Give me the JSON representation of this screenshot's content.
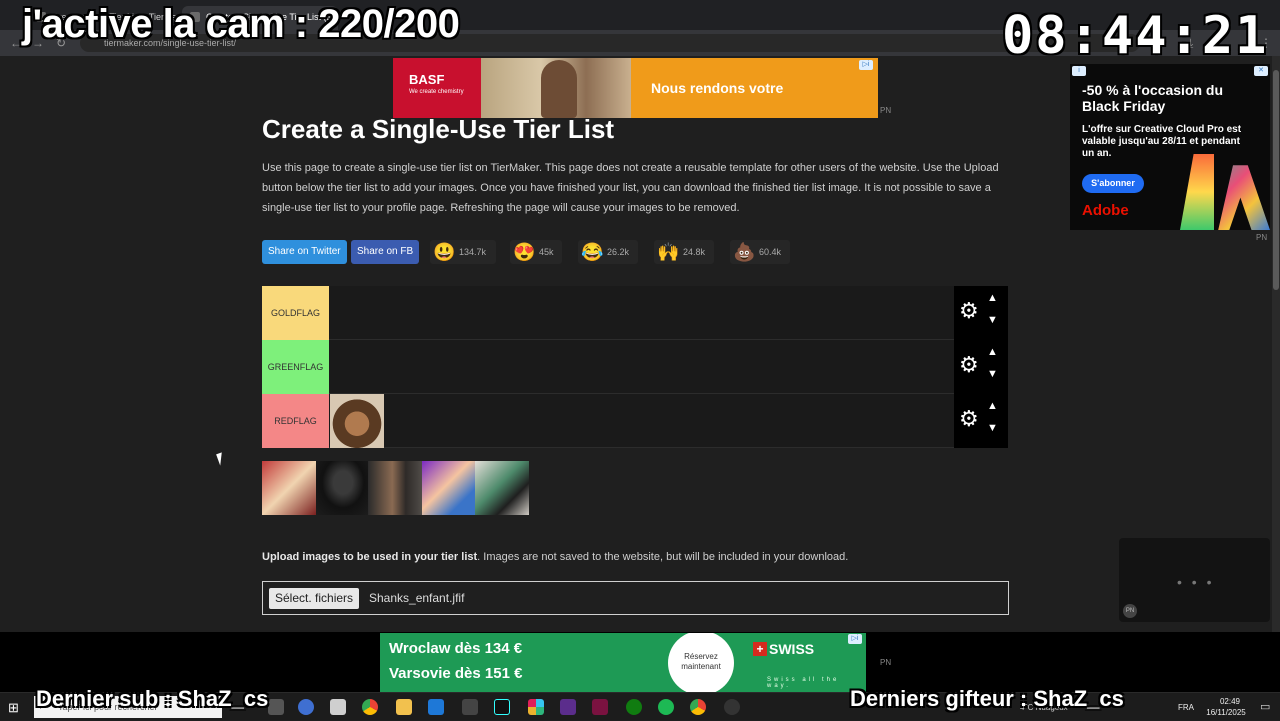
{
  "browser": {
    "tabs": [
      {
        "label": "Create a New Tier List - TierMa"
      },
      {
        "label": "Create a Single-Use Tier List (B"
      }
    ],
    "url": "tiermaker.com/single-use-tier-list/"
  },
  "overlay": {
    "title": "j'active la cam : 220/200",
    "clock": "08:44:21",
    "last_sub": "Dernier sub : ShaZ_cs",
    "last_gifter": "Derniers gifteur : ShaZ_cs"
  },
  "ad_top": {
    "brand": "BASF",
    "brand_tagline": "We create chemistry",
    "text": "Nous rendons votre",
    "pn": "PN"
  },
  "page": {
    "title": "Create a Single-Use Tier List",
    "description": "Use this page to create a single-use tier list on TierMaker. This page does not create a reusable template for other users of the website. Use the Upload button below the tier list to add your images. Once you have finished your list, you can download the finished tier list image. It is not possible to save a single-use tier list to your profile page. Refreshing the page will cause your images to be removed.",
    "share_twitter": "Share on Twitter",
    "share_fb": "Share on FB",
    "reactions": [
      {
        "emoji": "😃",
        "count": "134.7k"
      },
      {
        "emoji": "😍",
        "count": "45k"
      },
      {
        "emoji": "😂",
        "count": "26.2k"
      },
      {
        "emoji": "🙌",
        "count": "24.8k"
      },
      {
        "emoji": "💩",
        "count": "60.4k"
      }
    ],
    "tiers": [
      {
        "label": "GOLDFLAG",
        "color": "#f9d97b",
        "items": 0
      },
      {
        "label": "GREENFLAG",
        "color": "#7ef07b",
        "items": 0
      },
      {
        "label": "REDFLAG",
        "color": "#f48787",
        "items": 1
      }
    ],
    "pool_count": 5,
    "upload_bold": "Upload images to be used in your tier list",
    "upload_rest": ". Images are not saved to the website, but will be included in your download.",
    "file_button": "Sélect. fichiers",
    "file_name": "Shanks_enfant.jfif"
  },
  "ad_right": {
    "headline": "-50 % à l'occasion du Black Friday",
    "body": "L'offre sur Creative Cloud Pro est valable jusqu'au 28/11 et pendant un an.",
    "button": "S'abonner",
    "brand": "Adobe",
    "pn": "PN"
  },
  "ad_bottom": {
    "line1": "Wroclaw dès 134 €",
    "line2": "Varsovie dès 151 €",
    "cta": "Réservez maintenant",
    "brand": "SWISS",
    "tagline": "Swiss all the way.",
    "pn": "PN"
  },
  "taskbar": {
    "search_placeholder": "Taper ici pour rechercher",
    "weather": "4°C Nuageux",
    "lang": "FRA",
    "time": "02:49",
    "date": "16/11/2025"
  },
  "colors": {
    "twitter": "#2f90dd",
    "facebook": "#3b5cb0",
    "background": "#1f1f1f"
  }
}
